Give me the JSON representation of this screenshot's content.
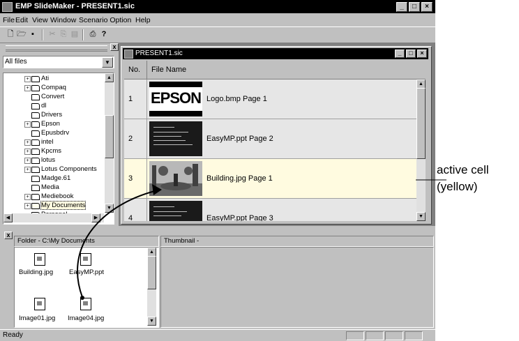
{
  "window": {
    "title": "EMP SlideMaker - PRESENT1.sic"
  },
  "menu": [
    "File",
    "Edit",
    "View",
    "Window",
    "Scenario Option",
    "Help"
  ],
  "left_pane": {
    "filter_value": "All files",
    "tree_items": [
      "Ati",
      "Compaq",
      "Convert",
      "dl",
      "Drivers",
      "Epson",
      "Epusbdrv",
      "intel",
      "Kpcms",
      "lotus",
      "Lotus Components",
      "Madge.61",
      "Media",
      "Mediebook",
      "My Documents",
      "Personal"
    ]
  },
  "document": {
    "title": "PRESENT1.sic",
    "col_no": "No.",
    "col_file": "File Name",
    "rows": [
      {
        "no": "1",
        "name": "Logo.bmp   Page 1",
        "thumb": "epson"
      },
      {
        "no": "2",
        "name": "EasyMP.ppt   Page 2",
        "thumb": "ppt"
      },
      {
        "no": "3",
        "name": "Building.jpg   Page 1",
        "thumb": "building"
      },
      {
        "no": "4",
        "name": "EasyMP.ppt   Page 3",
        "thumb": "ppt"
      }
    ],
    "logo_text": "EPSON"
  },
  "bottom": {
    "folder_label": "Folder - C:\\My Documents",
    "thumbnail_label": "Thumbnail -",
    "files": [
      "Building.jpg",
      "EasyMP.ppt",
      "Image01.jpg",
      "Image04.jpg"
    ]
  },
  "status": {
    "text": "Ready"
  },
  "annotation": {
    "line1": "active cell",
    "line2": "(yellow)"
  },
  "colors": {
    "active_row": "#fffbe0",
    "title_bar": "#000000",
    "window_face": "#c0c0c0"
  }
}
